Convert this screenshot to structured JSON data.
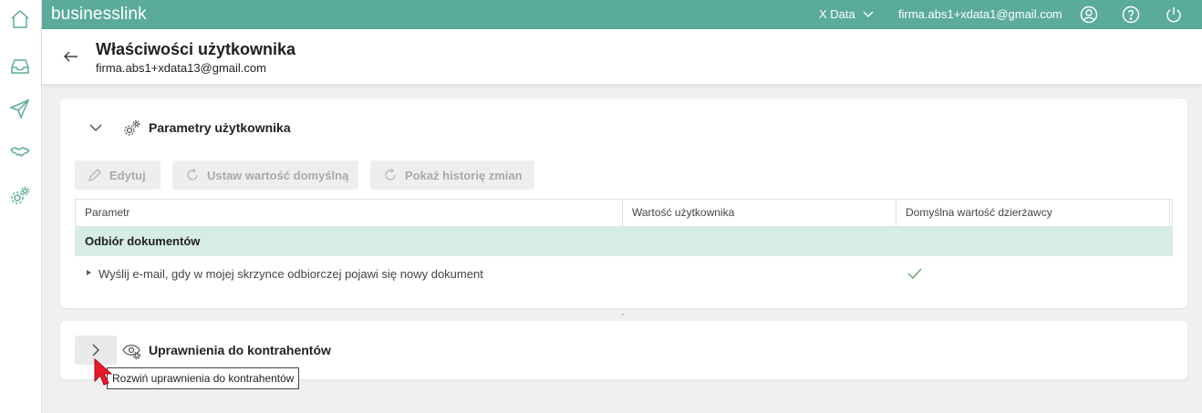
{
  "app": {
    "brand": "businesslink"
  },
  "topbar": {
    "tenant": "X Data",
    "user_email": "firma.abs1+xdata1@gmail.com"
  },
  "sidebar": {
    "items": [
      {
        "icon": "home-icon"
      },
      {
        "icon": "inbox-icon"
      },
      {
        "icon": "send-icon"
      },
      {
        "icon": "handshake-icon"
      },
      {
        "icon": "settings-gear-icon"
      }
    ]
  },
  "header": {
    "title": "Właściwości użytkownika",
    "subtitle": "firma.abs1+xdata13@gmail.com"
  },
  "params_section": {
    "title": "Parametry użytkownika",
    "toolbar": {
      "edit": "Edytuj",
      "set_default": "Ustaw wartość domyślną",
      "history": "Pokaż historię zmian"
    },
    "table": {
      "headers": [
        "Parametr",
        "Wartość użytkownika",
        "Domyślna wartość dzierżawcy"
      ],
      "group": "Odbiór dokumentów",
      "rows": [
        {
          "parameter": "Wyślij e-mail, gdy w mojej skrzynce odbiorczej pojawi się nowy dokument",
          "user_value": "",
          "tenant_default": "check"
        }
      ]
    }
  },
  "permissions_section": {
    "title": "Uprawnienia do kontrahentów",
    "tooltip": "Rozwiń uprawnienia do kontrahentów"
  },
  "colors": {
    "topbar": "#5bab9a",
    "group_row": "#d7ebe7",
    "check": "#5ba36e",
    "cursor": "#e8192c"
  }
}
